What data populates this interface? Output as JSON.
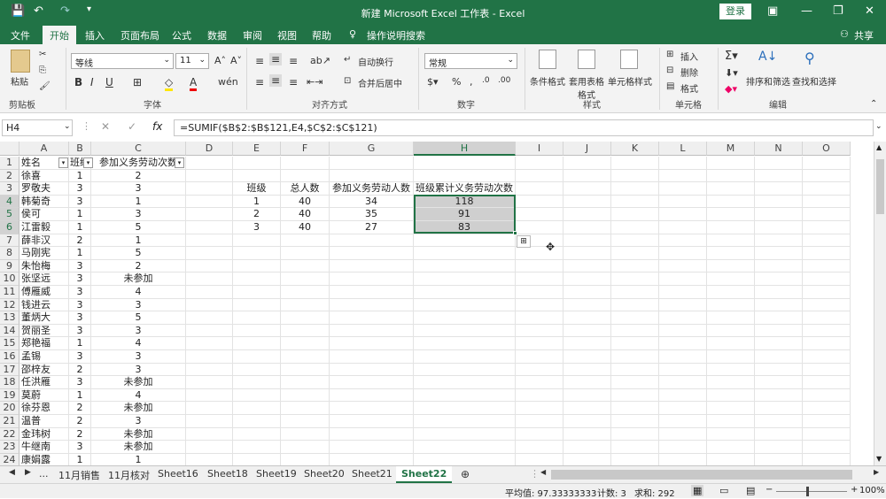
{
  "titlebar": {
    "title": "新建 Microsoft Excel 工作表 - Excel",
    "login": "登录"
  },
  "tabs": [
    "文件",
    "开始",
    "插入",
    "页面布局",
    "公式",
    "数据",
    "审阅",
    "视图",
    "帮助",
    "操作说明搜索"
  ],
  "share": "共享",
  "ribbon": {
    "paste": "粘贴",
    "clipboard": "剪贴板",
    "font_name": "等线",
    "font_size": "11",
    "font_group": "字体",
    "wrap": "自动换行",
    "merge": "合并后居中",
    "align_group": "对齐方式",
    "number_format": "常规",
    "number_group": "数字",
    "cond_format": "条件格式",
    "table_format": "套用表格格式",
    "cell_style": "单元格样式",
    "style_group": "样式",
    "insert": "插入",
    "delete": "删除",
    "format": "格式",
    "cells_group": "单元格",
    "sort_filter": "排序和筛选",
    "find_select": "查找和选择",
    "edit_group": "编辑"
  },
  "namebox": "H4",
  "formula": "=SUMIF($B$2:$B$121,E4,$C$2:$C$121)",
  "columns": [
    "A",
    "B",
    "C",
    "D",
    "E",
    "F",
    "G",
    "H",
    "I",
    "J",
    "K",
    "L",
    "M",
    "N",
    "O"
  ],
  "rows": [
    "1",
    "2",
    "3",
    "4",
    "5",
    "6",
    "7",
    "8",
    "9",
    "10",
    "11",
    "12",
    "13",
    "14",
    "15",
    "16",
    "17",
    "18",
    "19",
    "20",
    "21",
    "22",
    "23",
    "24"
  ],
  "data_a": [
    "姓名",
    "徐喜",
    "罗敬夫",
    "韩菊奇",
    "侯可",
    "江雷毅",
    "薛非汉",
    "马刚宪",
    "朱怡梅",
    "张坚远",
    "傅雁威",
    "钱进云",
    "董炳大",
    "贺丽圣",
    "郑艳福",
    "孟锡",
    "邵梓友",
    "任洪雁",
    "莫蔚",
    "徐芬恩",
    "温普",
    "金玮树",
    "牛继南",
    "康娟露"
  ],
  "data_b": [
    "班级",
    "1",
    "3",
    "3",
    "1",
    "1",
    "2",
    "1",
    "3",
    "3",
    "3",
    "3",
    "3",
    "3",
    "1",
    "3",
    "2",
    "3",
    "1",
    "2",
    "2",
    "2",
    "3",
    "1"
  ],
  "data_c": [
    "参加义务劳动次数",
    "2",
    "3",
    "1",
    "3",
    "5",
    "1",
    "5",
    "2",
    "未参加",
    "4",
    "3",
    "5",
    "3",
    "4",
    "3",
    "3",
    "未参加",
    "4",
    "未参加",
    "3",
    "未参加",
    "未参加",
    "1"
  ],
  "summary": {
    "headers": [
      "班级",
      "总人数",
      "参加义务劳动人数",
      "班级累计义务劳动次数"
    ],
    "rows": [
      [
        "1",
        "40",
        "34",
        "118"
      ],
      [
        "2",
        "40",
        "35",
        "91"
      ],
      [
        "3",
        "40",
        "27",
        "83"
      ]
    ]
  },
  "sheets": [
    "11月销售",
    "11月核对",
    "Sheet16",
    "Sheet18",
    "Sheet19",
    "Sheet20",
    "Sheet21",
    "Sheet22"
  ],
  "status": {
    "avg": "平均值: 97.33333333",
    "count": "计数: 3",
    "sum": "求和: 292",
    "zoom": "100%"
  }
}
